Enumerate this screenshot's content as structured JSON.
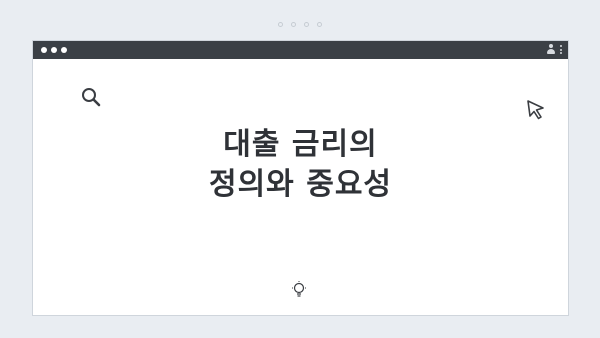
{
  "pager": {
    "count": 4,
    "active_index": null
  },
  "window": {
    "titlebar": {
      "traffic_lights": 3,
      "icons": [
        "user-icon",
        "kebab-menu-icon"
      ]
    },
    "content": {
      "headline": {
        "line1": "대출 금리의",
        "line2": "정의와 중요성"
      },
      "icons": [
        "search-icon",
        "cursor-icon",
        "lightbulb-icon"
      ]
    }
  },
  "colors": {
    "background": "#e9edf2",
    "titlebar": "#3b4046",
    "window": "#ffffff",
    "text": "#2f3237"
  }
}
